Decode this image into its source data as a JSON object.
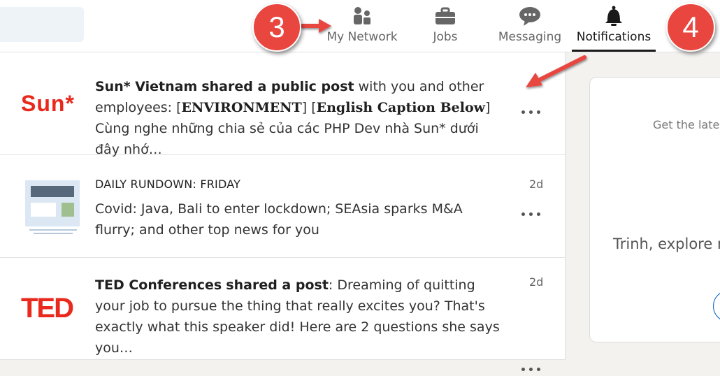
{
  "nav": {
    "items": [
      {
        "label": "My Network",
        "icon": "my-network-icon"
      },
      {
        "label": "Jobs",
        "icon": "briefcase-icon"
      },
      {
        "label": "Messaging",
        "icon": "chat-bubble-icon"
      },
      {
        "label": "Notifications",
        "icon": "bell-icon",
        "active": true
      }
    ]
  },
  "annotations": {
    "badge_3": "3",
    "badge_4": "4",
    "color": "#e8463f"
  },
  "notifications": [
    {
      "logo_text": "Sun*",
      "actor": "Sun* Vietnam",
      "action": "shared a public post",
      "rest": " with you and other employees: ",
      "tag1": "ENVIRONMENT",
      "tag2": "English Caption Below",
      "snippet": " Cùng nghe những chia sẻ của các PHP Dev nhà Sun* dưới đây nhớ…",
      "time": ""
    },
    {
      "logo": "news-thumbnail",
      "kicker": "DAILY RUNDOWN: FRIDAY",
      "text": "Covid: Java, Bali to enter lockdown; SEAsia sparks M&A flurry; and other top news for you",
      "time": "2d"
    },
    {
      "logo_text": "TED",
      "actor": "TED Conferences",
      "action": "shared a post",
      "text": ": Dreaming of quitting your job to pursue the thing that really excites you? That's exactly what this speaker did! Here are 2 questions she says you…",
      "time": "2d"
    }
  ],
  "side_card": {
    "line1": "Get the lates",
    "line2": "Trinh, explore re"
  },
  "colors": {
    "brand_red": "#e8291c",
    "accent_blue": "#0a66c2"
  }
}
